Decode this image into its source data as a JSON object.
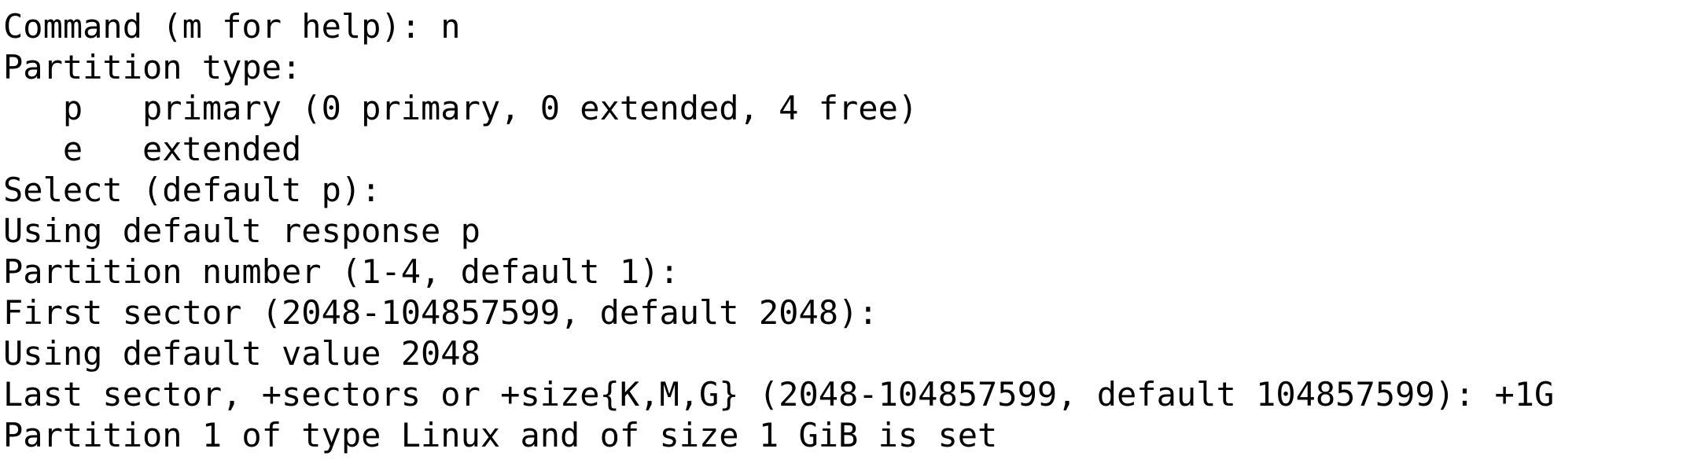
{
  "terminal": {
    "lines": [
      "Command (m for help): n",
      "Partition type:",
      "   p   primary (0 primary, 0 extended, 4 free)",
      "   e   extended",
      "Select (default p):",
      "Using default response p",
      "Partition number (1-4, default 1):",
      "First sector (2048-104857599, default 2048):",
      "Using default value 2048",
      "Last sector, +sectors or +size{K,M,G} (2048-104857599, default 104857599): +1G",
      "Partition 1 of type Linux and of size 1 GiB is set"
    ],
    "colors": {
      "background": "#ffffff",
      "foreground": "#000000"
    }
  }
}
